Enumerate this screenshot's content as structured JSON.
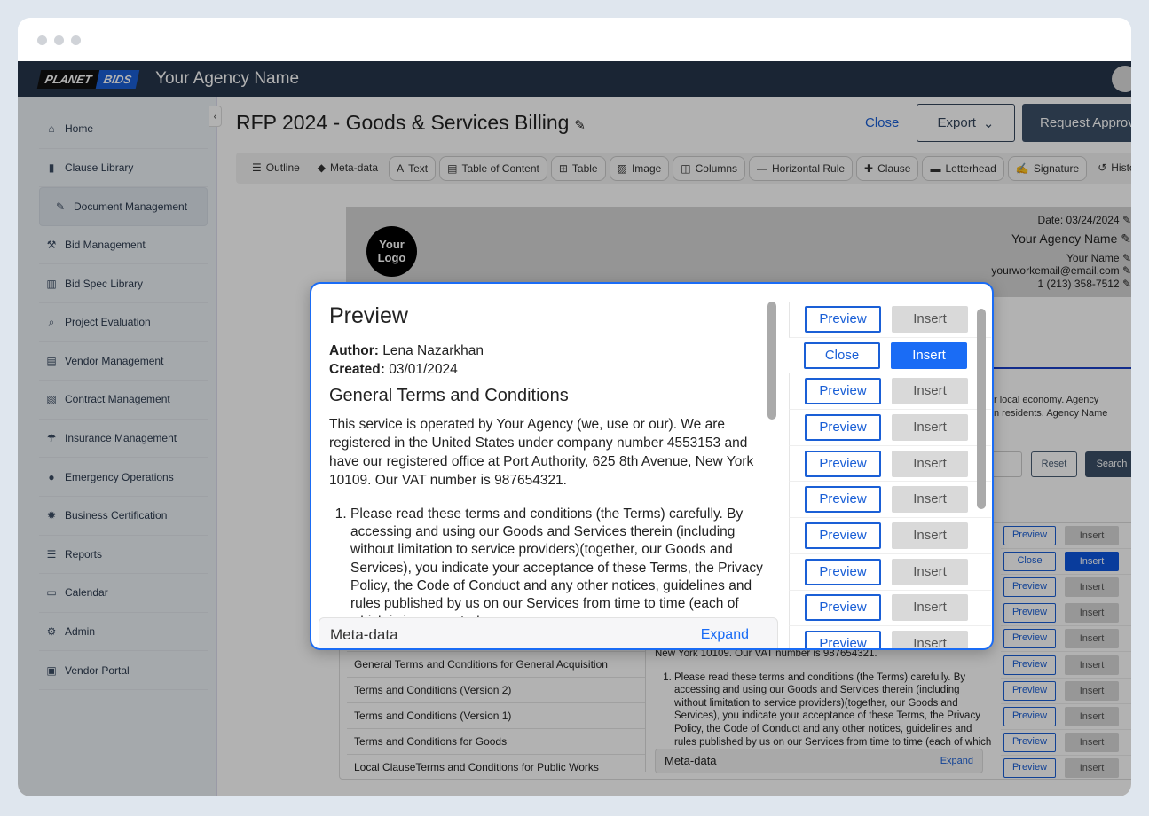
{
  "header": {
    "logo_left": "PLANET",
    "logo_right": "BIDS",
    "agency": "Your Agency Name"
  },
  "sidebar": {
    "items": [
      {
        "label": "Home",
        "icon": "home-icon",
        "glyph": "⌂"
      },
      {
        "label": "Clause Library",
        "icon": "bookmark-icon",
        "glyph": "▮"
      },
      {
        "label": "Document Management",
        "icon": "document-edit-icon",
        "glyph": "✎"
      },
      {
        "label": "Bid Management",
        "icon": "gavel-icon",
        "glyph": "⚒"
      },
      {
        "label": "Bid Spec Library",
        "icon": "book-open-icon",
        "glyph": "▥"
      },
      {
        "label": "Project Evaluation",
        "icon": "search-dollar-icon",
        "glyph": "⌕"
      },
      {
        "label": "Vendor Management",
        "icon": "id-card-icon",
        "glyph": "▤"
      },
      {
        "label": "Contract Management",
        "icon": "contract-icon",
        "glyph": "▧"
      },
      {
        "label": "Insurance Management",
        "icon": "umbrella-icon",
        "glyph": "☂"
      },
      {
        "label": "Emergency Operations",
        "icon": "fire-icon",
        "glyph": "●"
      },
      {
        "label": "Business Certification",
        "icon": "certificate-icon",
        "glyph": "✹"
      },
      {
        "label": "Reports",
        "icon": "chart-icon",
        "glyph": "☰"
      },
      {
        "label": "Calendar",
        "icon": "calendar-icon",
        "glyph": "▭"
      },
      {
        "label": "Admin",
        "icon": "gear-icon",
        "glyph": "⚙"
      },
      {
        "label": "Vendor Portal",
        "icon": "vendor-portal-icon",
        "glyph": "▣"
      }
    ],
    "active_index": 2
  },
  "doc": {
    "title": "RFP 2024 - Goods & Services Billing",
    "close": "Close",
    "export": "Export",
    "request": "Request Approval"
  },
  "toolbar": [
    {
      "label": "Outline",
      "icon": "list-icon",
      "glyph": "☰",
      "boxed": false
    },
    {
      "label": "Meta-data",
      "icon": "tag-icon",
      "glyph": "◆",
      "boxed": false
    },
    {
      "label": "Text",
      "icon": "text-icon",
      "glyph": "A",
      "boxed": true
    },
    {
      "label": "Table of Content",
      "icon": "toc-icon",
      "glyph": "▤",
      "boxed": true
    },
    {
      "label": "Table",
      "icon": "table-icon",
      "glyph": "⊞",
      "boxed": true
    },
    {
      "label": "Image",
      "icon": "image-icon",
      "glyph": "▨",
      "boxed": true
    },
    {
      "label": "Columns",
      "icon": "columns-icon",
      "glyph": "◫",
      "boxed": true
    },
    {
      "label": "Horizontal Rule",
      "icon": "hr-icon",
      "glyph": "—",
      "boxed": true
    },
    {
      "label": "Clause",
      "icon": "puzzle-icon",
      "glyph": "✚",
      "boxed": true
    },
    {
      "label": "Letterhead",
      "icon": "letterhead-icon",
      "glyph": "▬",
      "boxed": true
    },
    {
      "label": "Signature",
      "icon": "signature-icon",
      "glyph": "✍",
      "boxed": true
    },
    {
      "label": "History",
      "icon": "history-icon",
      "glyph": "↺",
      "boxed": false
    }
  ],
  "letterhead": {
    "logo": "Your Logo",
    "date": "Date: 03/24/2024",
    "agency": "Your Agency Name",
    "name": "Your Name",
    "email": "yourworkemail@email.com",
    "phone": "1 (213) 358-7512"
  },
  "background": {
    "text1": "r local economy. Agency",
    "text2": "n residents. Agency Name",
    "reset": "Reset",
    "search": "Search",
    "clauses": [
      "",
      "",
      "",
      "",
      "",
      "General Terms and Conditions for General Acquisition",
      "Terms and Conditions (Version 2)",
      "Terms and Conditions (Version 1)",
      "Terms and Conditions for Goods",
      "Local ClauseTerms and Conditions for Public Works"
    ],
    "preview_tail": "New York 10109. Our VAT number is 987654321.",
    "meta": "Meta-data",
    "expand": "Expand"
  },
  "buttons": {
    "preview": "Preview",
    "insert": "Insert",
    "close": "Close"
  },
  "modal": {
    "title": "Preview",
    "author_label": "Author:",
    "author": "Lena Nazarkhan",
    "created_label": "Created:",
    "created": "03/01/2024",
    "heading": "General Terms and Conditions",
    "para": "This service is operated by Your Agency (we, use or our). We are registered in the United States under company number 4553153 and have our registered office at Port Authority, 625 8th Avenue, New York 10109. Our VAT number is 987654321.",
    "item1": "Please read these terms and conditions (the Terms) carefully. By accessing and using our Goods and Services therein (including without limitation to service providers)(together, our Goods and Services), you indicate your acceptance of these Terms, the Privacy Policy, the Code of Conduct and any other notices, guidelines and rules published by us on our Services from time to time (each of which is incorporated",
    "meta": "Meta-data",
    "expand": "Expand",
    "selected_row": 1
  }
}
